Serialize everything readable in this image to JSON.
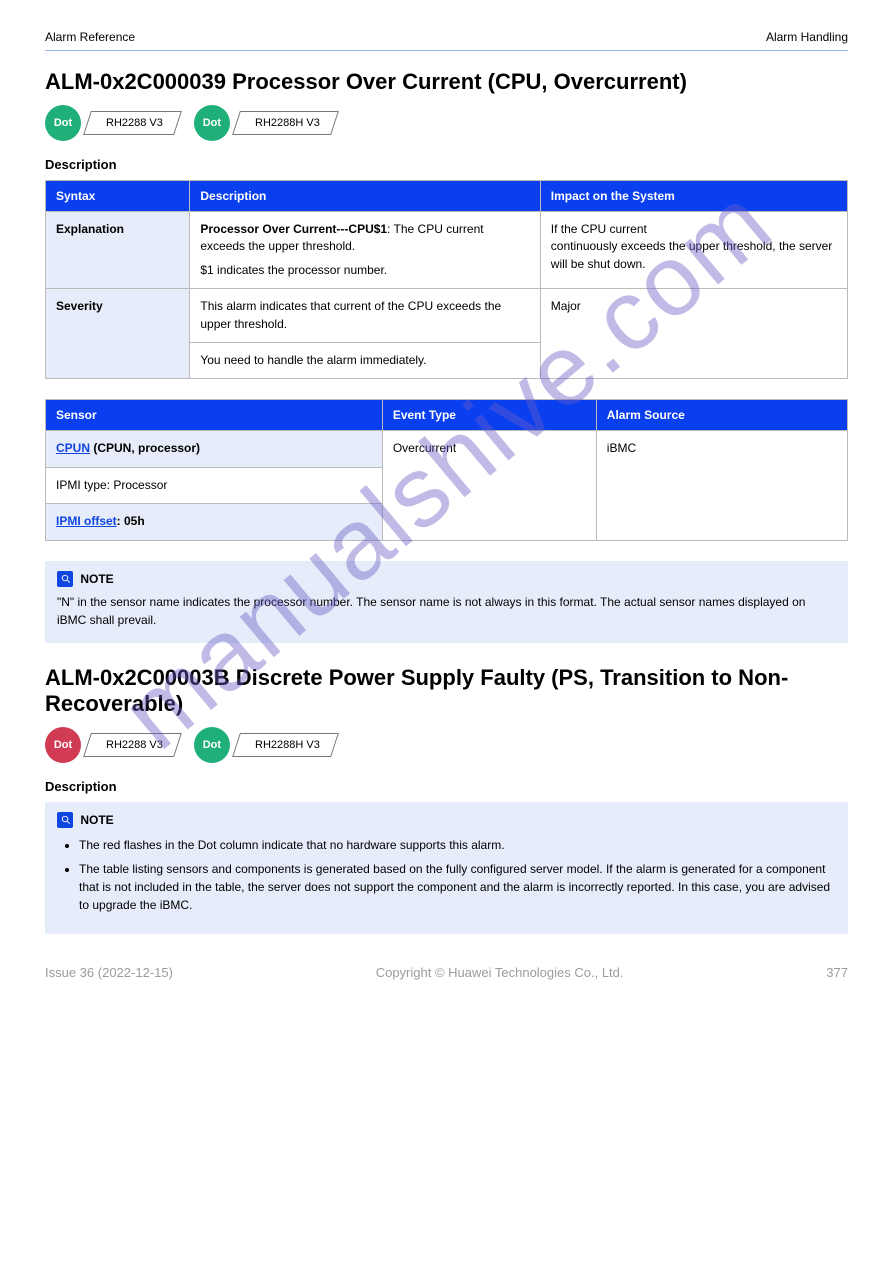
{
  "header": {
    "left": "Alarm Reference",
    "right": "Alarm Handling"
  },
  "watermark": "manualshive.com",
  "alarm1": {
    "title": "ALM-0x2C000039 Processor Over Current (CPU, Overcurrent)",
    "dots": [
      {
        "style": "green",
        "code": "Dot",
        "label": "RH2288 V3"
      },
      {
        "style": "green",
        "code": "Dot",
        "label": "RH2288H V3"
      }
    ]
  },
  "desc_h": "Description",
  "table1": {
    "cols": [
      "Syntax",
      "Description",
      "Impact on the System"
    ],
    "rows": [
      {
        "k": "Explanation",
        "c1_b": "Processor Over Current---CPU$1",
        "c1_a": ": The CPU current exceeds the upper threshold.",
        "c1_p": "$1 indicates the processor number.",
        "c2_p1": "If the CPU current",
        "c2_p2": "continuously exceeds the upper threshold, the server will be shut down."
      },
      {
        "k": "Severity",
        "c1": "This alarm indicates that current of the CPU exceeds the upper threshold.",
        "c2": "Major"
      },
      {
        "k": null,
        "c1": "You need to handle the alarm immediately.",
        "c2": null,
        "merged_left": true
      }
    ]
  },
  "table2": {
    "cols": [
      "Sensor",
      "Event Type",
      "Alarm Source"
    ],
    "rows": [
      {
        "k_link": "CPUN",
        "k_after": " (CPUN, processor)",
        "c1": "Overcurrent",
        "c2": "iBMC"
      },
      {
        "k": "IPMI type: Processor",
        "c1": null,
        "c2": null,
        "merged": true
      },
      {
        "k_link": "IPMI offset",
        "k_after": ": 05h",
        "c1": null,
        "c2": null,
        "merged": true
      }
    ]
  },
  "note1": {
    "title": "NOTE",
    "text": "\"N\" in the sensor name indicates the processor number. The sensor name is not always in this format. The actual sensor names displayed on iBMC shall prevail."
  },
  "alarm2": {
    "title": "ALM-0x2C00003B Discrete Power Supply Faulty (PS, Transition to Non-Recoverable)",
    "dots": [
      {
        "style": "red",
        "code": "Dot",
        "label": "RH2288 V3"
      },
      {
        "style": "green",
        "code": "Dot",
        "label": "RH2288H V3"
      }
    ]
  },
  "desc_h2": "Description",
  "note2": {
    "title": "NOTE",
    "bullets": [
      "The red flashes in the Dot column indicate that no hardware supports this alarm.",
      "The table listing sensors and components is generated based on the fully configured server model. If the alarm is generated for a component that is not included in the table, the server does not support the component and the alarm is incorrectly reported. In this case, you are advised to upgrade the iBMC."
    ]
  },
  "footer": {
    "left": "Issue 36 (2022-12-15)",
    "center": "Copyright © Huawei Technologies Co., Ltd.",
    "right": "377"
  }
}
